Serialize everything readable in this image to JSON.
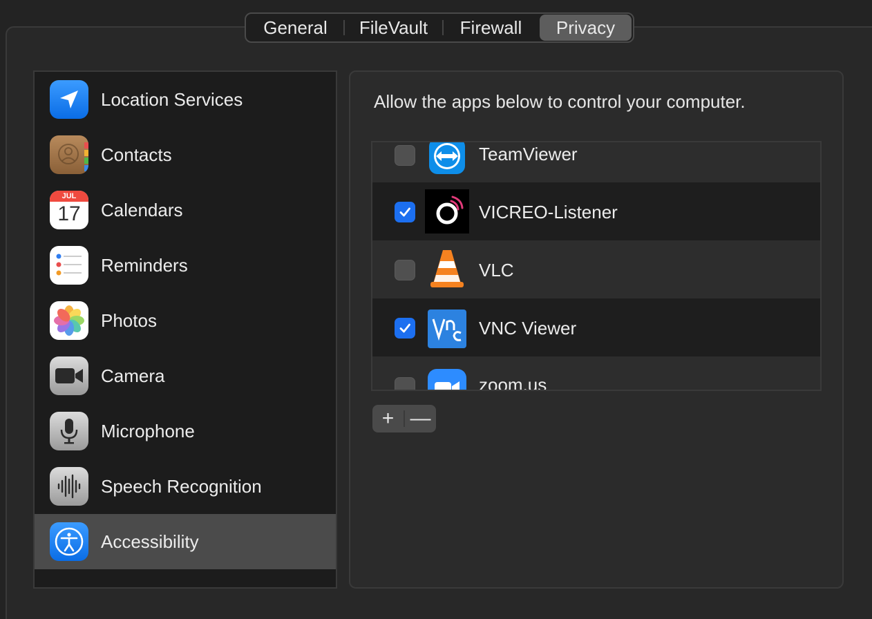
{
  "tabs": [
    {
      "label": "General",
      "active": false
    },
    {
      "label": "FileVault",
      "active": false
    },
    {
      "label": "Firewall",
      "active": false
    },
    {
      "label": "Privacy",
      "active": true
    }
  ],
  "sidebar": {
    "items": [
      {
        "label": "Location Services",
        "icon": "location-arrow-icon"
      },
      {
        "label": "Contacts",
        "icon": "contacts-icon"
      },
      {
        "label": "Calendars",
        "icon": "calendar-icon",
        "month": "JUL",
        "day": "17"
      },
      {
        "label": "Reminders",
        "icon": "reminders-icon"
      },
      {
        "label": "Photos",
        "icon": "photos-icon"
      },
      {
        "label": "Camera",
        "icon": "camera-icon"
      },
      {
        "label": "Microphone",
        "icon": "microphone-icon"
      },
      {
        "label": "Speech Recognition",
        "icon": "speech-recognition-icon"
      },
      {
        "label": "Accessibility",
        "icon": "accessibility-icon",
        "selected": true
      }
    ]
  },
  "main": {
    "prompt": "Allow the apps below to control your computer.",
    "apps": [
      {
        "name": "TeamViewer",
        "checked": false,
        "icon": "teamviewer-icon"
      },
      {
        "name": "VICREO-Listener",
        "checked": true,
        "icon": "vicreo-icon"
      },
      {
        "name": "VLC",
        "checked": false,
        "icon": "vlc-cone-icon"
      },
      {
        "name": "VNC Viewer",
        "checked": true,
        "icon": "vnc-viewer-icon"
      },
      {
        "name": "zoom.us",
        "checked": false,
        "icon": "zoom-icon"
      }
    ],
    "add_label": "+",
    "remove_label": "—"
  },
  "colors": {
    "accent": "#1c6ff0",
    "selected_row": "#4b4b4b",
    "background": "#232323"
  }
}
